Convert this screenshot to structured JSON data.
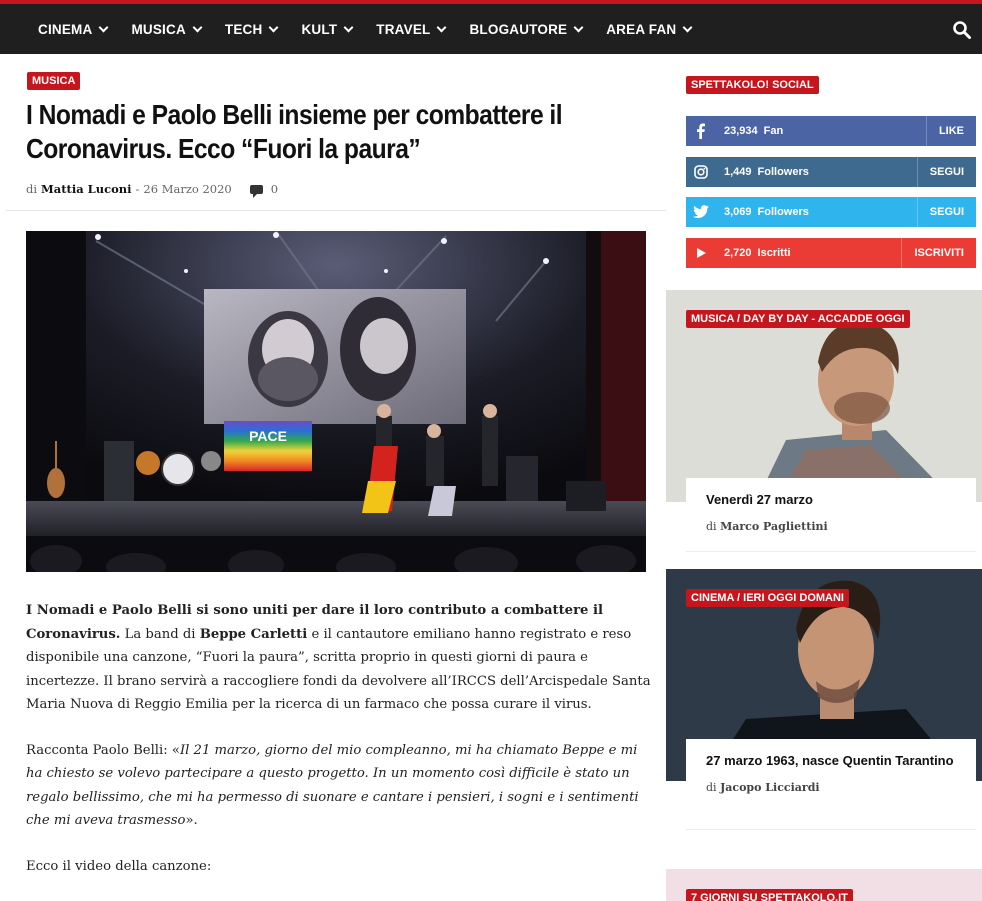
{
  "nav": {
    "items": [
      {
        "label": "CINEMA"
      },
      {
        "label": "MUSICA"
      },
      {
        "label": "TECH"
      },
      {
        "label": "KULT"
      },
      {
        "label": "TRAVEL"
      },
      {
        "label": "BLOGAUTORE"
      },
      {
        "label": "AREA FAN"
      }
    ],
    "search_icon": "search-icon"
  },
  "article": {
    "category": "MUSICA",
    "title": "I Nomadi e Paolo Belli insieme per combattere il Coronavirus. Ecco “Fuori la paura”",
    "byline_prefix": "di",
    "author": "Mattia Luconi",
    "separator": "-",
    "date": "26 Marzo 2020",
    "comments": "0",
    "photo_banner_text": "PACE",
    "p1": {
      "b1": "I Nomadi e Paolo Belli si sono uniti per dare il loro contributo a combattere il Coronavirus.",
      "t1": " La band di ",
      "b2": "Beppe Carletti",
      "t2": " e il cantautore emiliano hanno registrato e reso disponibile una canzone, “Fuori la paura”, scritta proprio in questi giorni di paura e incertezze. Il brano servirà a raccogliere fondi da devolvere all’IRCCS dell’Arcispedale Santa Maria Nuova di Reggio Emilia per la ricerca di un farmaco che possa curare il virus."
    },
    "p2": {
      "t1": "Racconta Paolo Belli: «",
      "i1": "Il 21 marzo, giorno del mio compleanno, mi ha chiamato Beppe e mi ha chiesto se volevo partecipare a questo progetto. In un momento così difficile è stato un regalo bellissimo, che mi ha permesso di suonare e cantare i pensieri, i sogni e i sentimenti che mi aveva trasmesso",
      "t2": "»."
    },
    "p3": "Ecco il video della canzone:"
  },
  "sidebar": {
    "social_title": "SPETTAKOLO! SOCIAL",
    "social": [
      {
        "icon": "facebook-icon",
        "count": "23,934",
        "unit": "Fan",
        "action": "LIKE",
        "color": "#4b64a3"
      },
      {
        "icon": "instagram-icon",
        "count": "1,449",
        "unit": "Followers",
        "action": "SEGUI",
        "color": "#3f6a90"
      },
      {
        "icon": "twitter-icon",
        "count": "3,069",
        "unit": "Followers",
        "action": "SEGUI",
        "color": "#2fb4ee"
      },
      {
        "icon": "youtube-icon",
        "count": "2,720",
        "unit": "Iscritti",
        "action": "ISCRIVITI",
        "color": "#ea3c35"
      }
    ],
    "cards": [
      {
        "tag": "MUSICA / DAY BY DAY - ACCADDE OGGI",
        "title": "Venerdì 27 marzo",
        "by_prefix": "di",
        "author": "Marco Pagliettini"
      },
      {
        "tag": "CINEMA / IERI OGGI DOMANI",
        "title": "27 marzo 1963, nasce Quentin Tarantino",
        "by_prefix": "di",
        "author": "Jacopo Licciardi"
      }
    ],
    "promo_tag": "7 GIORNI SU SPETTAKOLO.IT"
  },
  "colors": {
    "accent": "#c4161c",
    "nav_bg": "#1f1f1f"
  }
}
